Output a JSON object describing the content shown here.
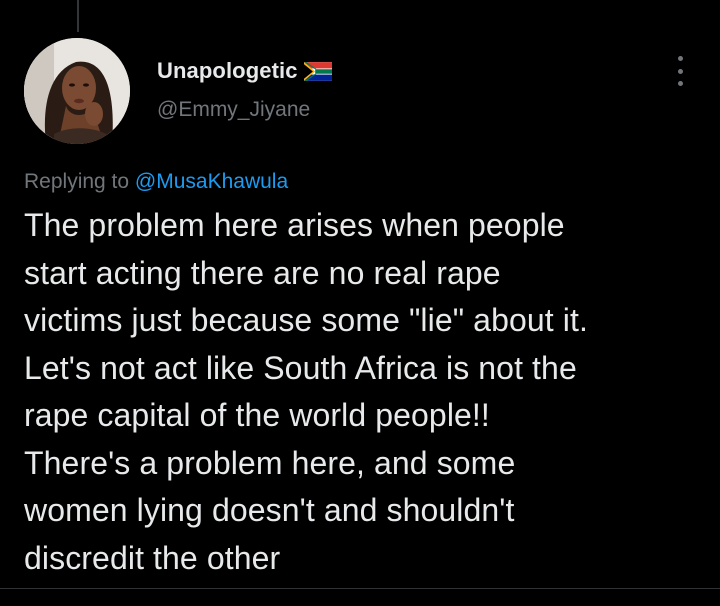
{
  "tweet": {
    "author": {
      "display_name": "Unapologetic",
      "flag_icon": "south-africa-flag-icon",
      "handle": "@Emmy_Jiyane",
      "avatar_icon": "user-avatar"
    },
    "reply": {
      "prefix": "Replying to",
      "mention": "@MusaKhawula"
    },
    "body_lines": [
      "The problem here arises when people",
      "start acting there are no real rape",
      "victims just because some \"lie\" about it.",
      "Let's not act like South Africa is not the",
      "rape capital of the world people!!",
      "There's a problem here, and some",
      "women lying doesn't and shouldn't",
      "discredit the other"
    ],
    "more_icon": "more-options-icon"
  },
  "colors": {
    "background": "#000000",
    "text_primary": "#e7e9ea",
    "text_secondary": "#71767b",
    "link": "#1d9bf0"
  }
}
